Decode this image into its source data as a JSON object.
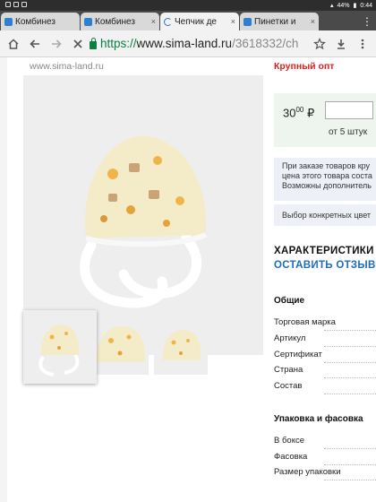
{
  "statusbar": {
    "battery": "44%",
    "time": "0:44"
  },
  "tabs": [
    {
      "title": "Комбинез",
      "close": ""
    },
    {
      "title": "Комбинез",
      "close": "×"
    },
    {
      "title": "Чепчик де",
      "close": "×"
    },
    {
      "title": "Пинетки и",
      "close": "×"
    }
  ],
  "toolbar": {
    "url_scheme": "https://",
    "url_host": "www.sima-land.ru",
    "url_path": "/3618332/ch"
  },
  "page": {
    "site_link": "www.sima-land.ru",
    "badge_opt": "Крупный опт",
    "price_main": "30",
    "price_cents": "00",
    "price_currency": "₽",
    "min_qty": "от 5 штук",
    "note_line1": "При заказе товаров кру",
    "note_line2": "цена этого товара соста",
    "note_line3": "Возможны дополнитель",
    "select_text": "Выбор конкретных цвет",
    "characteristics": "ХАРАКТЕРИСТИКИ",
    "leave_review": "ОСТАВИТЬ ОТЗЫВ",
    "general_title": "Общие",
    "general_rows": [
      "Торговая марка",
      "Артикул",
      "Сертификат",
      "Страна",
      "Состав"
    ],
    "pack_title": "Упаковка и фасовка",
    "pack_rows": [
      "В боксе",
      "Фасовка",
      "Размер упаковки"
    ]
  }
}
